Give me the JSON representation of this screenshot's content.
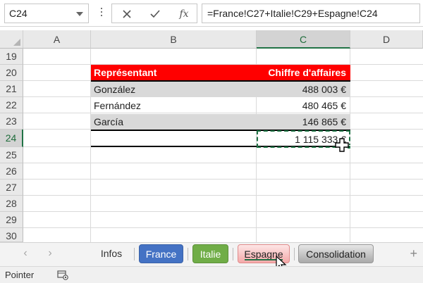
{
  "formula_bar": {
    "name_box": "C24",
    "cancel_icon": "cancel-icon",
    "enter_icon": "checkmark-icon",
    "function_label": "fx",
    "formula": "=France!C27+Italie!C29+Espagne!C24"
  },
  "columns": [
    "A",
    "B",
    "C",
    "D"
  ],
  "selected_column": "C",
  "rows": [
    "19",
    "20",
    "21",
    "22",
    "23",
    "24",
    "25",
    "26",
    "27",
    "28",
    "29",
    "30"
  ],
  "selected_row": "24",
  "table": {
    "header": [
      "Représentant",
      "Chiffre d'affaires"
    ],
    "records": [
      {
        "name": "González",
        "amount": "488 003 €"
      },
      {
        "name": "Fernández",
        "amount": "480 465 €"
      },
      {
        "name": "García",
        "amount": "146 865 €"
      }
    ],
    "total": "1 115 333 €"
  },
  "sheet_tabs": [
    "Infos",
    "France",
    "Italie",
    "Espagne",
    "Consolidation"
  ],
  "active_tab": "Espagne",
  "colors": {
    "header_bg": "#ff0000",
    "france": "#4472c4",
    "italie": "#70ad47",
    "espagne": "#f4a9a9",
    "consolidation": "#a9a9a9",
    "excel_green": "#217346"
  },
  "status": {
    "mode": "Pointer"
  }
}
